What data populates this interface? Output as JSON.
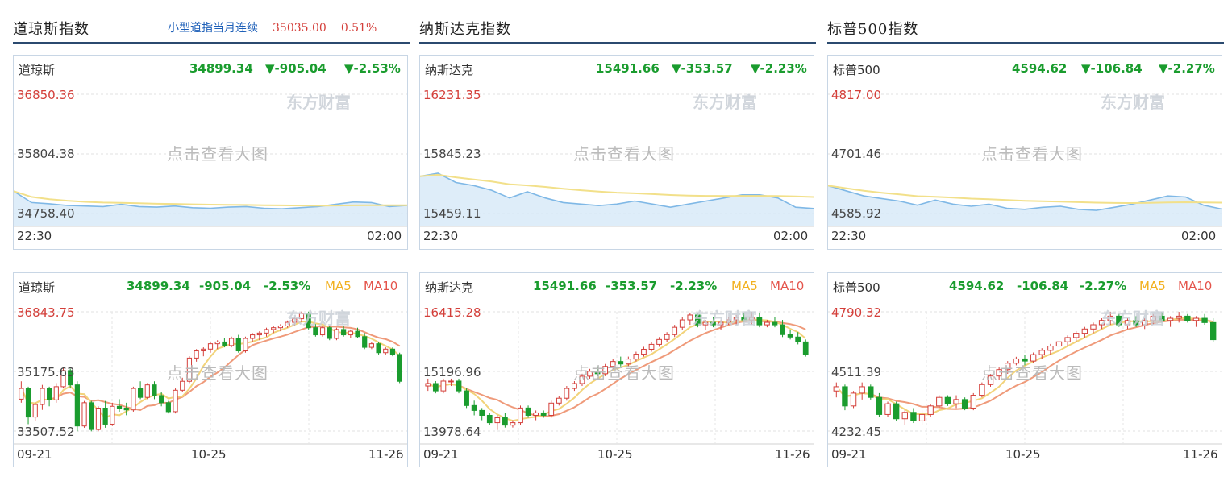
{
  "columns": [
    {
      "header": "道琼斯指数",
      "futures": {
        "name": "小型道指当月连续",
        "price": "35035.00",
        "pct": "0.51%"
      },
      "intraday": {
        "name": "道琼斯",
        "price": "34899.34",
        "change": "▼-905.04",
        "pct": "▼-2.53%",
        "y_high": "36850.36",
        "y_mid": "35804.38",
        "y_low": "34758.40",
        "x_start": "22:30",
        "x_end": "02:00"
      },
      "kline": {
        "name": "道琼斯",
        "price": "34899.34",
        "change": "-905.04",
        "pct": "-2.53%",
        "ma5": "MA5",
        "ma10": "MA10",
        "y_high": "36843.75",
        "y_mid": "35175.63",
        "y_low": "33507.52",
        "x_ticks": [
          "09-21",
          "10-25",
          "11-26"
        ]
      }
    },
    {
      "header": "纳斯达克指数",
      "intraday": {
        "name": "纳斯达克",
        "price": "15491.66",
        "change": "▼-353.57",
        "pct": "▼-2.23%",
        "y_high": "16231.35",
        "y_mid": "15845.23",
        "y_low": "15459.11",
        "x_start": "22:30",
        "x_end": "02:00"
      },
      "kline": {
        "name": "纳斯达克",
        "price": "15491.66",
        "change": "-353.57",
        "pct": "-2.23%",
        "ma5": "MA5",
        "ma10": "MA10",
        "y_high": "16415.28",
        "y_mid": "15196.96",
        "y_low": "13978.64",
        "x_ticks": [
          "09-21",
          "10-25",
          "11-26"
        ]
      }
    },
    {
      "header": "标普500指数",
      "intraday": {
        "name": "标普500",
        "price": "4594.62",
        "change": "▼-106.84",
        "pct": "▼-2.27%",
        "y_high": "4817.00",
        "y_mid": "4701.46",
        "y_low": "4585.92",
        "x_start": "22:30",
        "x_end": "02:00"
      },
      "kline": {
        "name": "标普500",
        "price": "4594.62",
        "change": "-106.84",
        "pct": "-2.27%",
        "ma5": "MA5",
        "ma10": "MA10",
        "y_high": "4790.32",
        "y_mid": "4511.39",
        "y_low": "4232.45",
        "x_ticks": [
          "09-21",
          "10-25",
          "11-26"
        ]
      }
    }
  ],
  "watermark": "东方财富",
  "hint": "点击查看大图",
  "colors": {
    "up": "#d43f3a",
    "down": "#1a9c2e",
    "ma5": "#f2d37a",
    "ma10": "#ef9a7a",
    "area": "#d6e9f8",
    "line": "#7fb8e6",
    "prev_close": "#f2e08a"
  },
  "chart_data": [
    {
      "type": "line",
      "title": "道琼斯",
      "x_range": [
        "22:30",
        "02:00"
      ],
      "ylim": [
        34758.4,
        36850.36
      ],
      "values": [
        35150,
        34950,
        34930,
        34900,
        34890,
        34880,
        34920,
        34880,
        34870,
        34890,
        34860,
        34850,
        34870,
        34880,
        34850,
        34840,
        34860,
        34880,
        34920,
        34960,
        34950,
        34880,
        34899.34
      ],
      "prev_close": 35804.38
    },
    {
      "type": "line",
      "title": "纳斯达克",
      "x_range": [
        "22:30",
        "02:00"
      ],
      "ylim": [
        15459.11,
        16231.35
      ],
      "values": [
        15700,
        15720,
        15660,
        15640,
        15610,
        15560,
        15600,
        15560,
        15530,
        15520,
        15510,
        15520,
        15540,
        15520,
        15500,
        15520,
        15540,
        15560,
        15580,
        15580,
        15560,
        15500,
        15491.66
      ],
      "prev_close": 15845.23
    },
    {
      "type": "line",
      "title": "标普500",
      "x_range": [
        "22:30",
        "02:00"
      ],
      "ylim": [
        4585.92,
        4817.0
      ],
      "values": [
        4640,
        4630,
        4620,
        4615,
        4610,
        4602,
        4612,
        4604,
        4600,
        4604,
        4596,
        4594,
        4598,
        4600,
        4594,
        4592,
        4598,
        4604,
        4612,
        4620,
        4618,
        4602,
        4594.62
      ],
      "prev_close": 4701.46
    },
    {
      "type": "candlestick",
      "title": "道琼斯",
      "ylim": [
        33507.52,
        36843.75
      ],
      "x_ticks": [
        "09-21",
        "10-25",
        "11-26"
      ],
      "ohlc": [
        [
          34400,
          34900,
          34300,
          34700
        ],
        [
          34700,
          34750,
          33700,
          33900
        ],
        [
          33900,
          34300,
          33800,
          34250
        ],
        [
          34250,
          34800,
          34100,
          34700
        ],
        [
          34700,
          34750,
          34200,
          34380
        ],
        [
          34380,
          34850,
          34300,
          34750
        ],
        [
          34750,
          35300,
          34700,
          35200
        ],
        [
          35200,
          35250,
          34700,
          34800
        ],
        [
          34800,
          34900,
          33500,
          33650
        ],
        [
          33650,
          34350,
          33600,
          34300
        ],
        [
          34300,
          34350,
          33500,
          33550
        ],
        [
          33550,
          34200,
          33500,
          34150
        ],
        [
          34150,
          34350,
          33600,
          33700
        ],
        [
          33700,
          34300,
          33650,
          34200
        ],
        [
          34200,
          34400,
          34050,
          34150
        ],
        [
          34150,
          34300,
          33950,
          34100
        ],
        [
          34100,
          34750,
          34050,
          34700
        ],
        [
          34700,
          34900,
          34400,
          34450
        ],
        [
          34450,
          34850,
          34400,
          34800
        ],
        [
          34800,
          34900,
          34400,
          34500
        ],
        [
          34500,
          34600,
          34200,
          34300
        ],
        [
          34300,
          34350,
          34000,
          34050
        ],
        [
          34050,
          34700,
          34000,
          34650
        ],
        [
          34650,
          35000,
          34600,
          34900
        ],
        [
          34900,
          35600,
          34850,
          35550
        ],
        [
          35550,
          35800,
          35450,
          35750
        ],
        [
          35750,
          35850,
          35600,
          35800
        ],
        [
          35800,
          36000,
          35700,
          35950
        ],
        [
          35950,
          36050,
          35800,
          36000
        ],
        [
          36000,
          36100,
          35850,
          35900
        ],
        [
          35900,
          36150,
          35850,
          36100
        ],
        [
          36100,
          36200,
          35700,
          35750
        ],
        [
          35750,
          36150,
          35700,
          36100
        ],
        [
          36100,
          36250,
          36000,
          36200
        ],
        [
          36200,
          36300,
          36050,
          36250
        ],
        [
          36250,
          36400,
          36150,
          36350
        ],
        [
          36350,
          36450,
          36250,
          36400
        ],
        [
          36400,
          36500,
          36300,
          36450
        ],
        [
          36450,
          36600,
          36400,
          36550
        ],
        [
          36550,
          36700,
          36450,
          36650
        ],
        [
          36650,
          36850,
          36550,
          36800
        ],
        [
          36800,
          36850,
          36350,
          36400
        ],
        [
          36400,
          36500,
          36150,
          36200
        ],
        [
          36200,
          36450,
          36150,
          36400
        ],
        [
          36400,
          36450,
          36050,
          36100
        ],
        [
          36100,
          36400,
          36050,
          36350
        ],
        [
          36350,
          36450,
          36150,
          36200
        ],
        [
          36200,
          36350,
          36100,
          36300
        ],
        [
          36300,
          36400,
          36100,
          36150
        ],
        [
          36150,
          36250,
          35800,
          35850
        ],
        [
          35850,
          36000,
          35800,
          35950
        ],
        [
          35950,
          36000,
          35650,
          35700
        ],
        [
          35700,
          35850,
          35650,
          35800
        ],
        [
          35800,
          35850,
          35600,
          35650
        ],
        [
          35650,
          35700,
          34850,
          34900
        ]
      ]
    },
    {
      "type": "candlestick",
      "title": "纳斯达克",
      "ylim": [
        13978.64,
        16415.28
      ],
      "x_ticks": [
        "09-21",
        "10-25",
        "11-26"
      ],
      "ohlc": [
        [
          14900,
          15050,
          14800,
          14950
        ],
        [
          14950,
          15000,
          14750,
          14800
        ],
        [
          14800,
          15050,
          14750,
          15000
        ],
        [
          15000,
          15050,
          14900,
          15000
        ],
        [
          15000,
          15050,
          14750,
          14800
        ],
        [
          14800,
          14850,
          14450,
          14500
        ],
        [
          14500,
          14600,
          14300,
          14400
        ],
        [
          14400,
          14450,
          14200,
          14300
        ],
        [
          14300,
          14350,
          14100,
          14150
        ],
        [
          14150,
          14300,
          14000,
          14250
        ],
        [
          14250,
          14350,
          14050,
          14100
        ],
        [
          14100,
          14200,
          14050,
          14150
        ],
        [
          14150,
          14500,
          14100,
          14450
        ],
        [
          14450,
          14500,
          14250,
          14300
        ],
        [
          14300,
          14400,
          14200,
          14350
        ],
        [
          14350,
          14400,
          14250,
          14300
        ],
        [
          14300,
          14600,
          14250,
          14550
        ],
        [
          14550,
          14700,
          14500,
          14650
        ],
        [
          14650,
          14900,
          14600,
          14850
        ],
        [
          14850,
          15000,
          14800,
          14950
        ],
        [
          14950,
          15150,
          14900,
          15100
        ],
        [
          15100,
          15250,
          15050,
          15200
        ],
        [
          15200,
          15300,
          15100,
          15150
        ],
        [
          15150,
          15350,
          15100,
          15300
        ],
        [
          15300,
          15450,
          15250,
          15400
        ],
        [
          15400,
          15500,
          15300,
          15350
        ],
        [
          15350,
          15500,
          15300,
          15450
        ],
        [
          15450,
          15600,
          15400,
          15550
        ],
        [
          15550,
          15700,
          15500,
          15650
        ],
        [
          15650,
          15800,
          15600,
          15750
        ],
        [
          15750,
          15900,
          15700,
          15850
        ],
        [
          15850,
          16000,
          15800,
          15950
        ],
        [
          15950,
          16150,
          15900,
          16100
        ],
        [
          16100,
          16300,
          16050,
          16250
        ],
        [
          16250,
          16400,
          16150,
          16350
        ],
        [
          16350,
          16400,
          16100,
          16150
        ],
        [
          16150,
          16250,
          16050,
          16200
        ],
        [
          16200,
          16300,
          16100,
          16150
        ],
        [
          16150,
          16250,
          16050,
          16200
        ],
        [
          16200,
          16300,
          16150,
          16250
        ],
        [
          16250,
          16350,
          16150,
          16300
        ],
        [
          16300,
          16400,
          16200,
          16250
        ],
        [
          16250,
          16415,
          16150,
          16300
        ],
        [
          16300,
          16400,
          16100,
          16150
        ],
        [
          16150,
          16250,
          16100,
          16200
        ],
        [
          16200,
          16300,
          16100,
          16150
        ],
        [
          16150,
          16250,
          15900,
          15950
        ],
        [
          15950,
          16050,
          15850,
          15900
        ],
        [
          15900,
          16000,
          15750,
          15800
        ],
        [
          15800,
          15850,
          15500,
          15550
        ]
      ]
    },
    {
      "type": "candlestick",
      "title": "标普500",
      "ylim": [
        4232.45,
        4790.32
      ],
      "x_ticks": [
        "09-21",
        "10-25",
        "11-26"
      ],
      "ohlc": [
        [
          4420,
          4460,
          4390,
          4440
        ],
        [
          4440,
          4450,
          4330,
          4350
        ],
        [
          4350,
          4420,
          4340,
          4410
        ],
        [
          4410,
          4460,
          4380,
          4440
        ],
        [
          4440,
          4450,
          4380,
          4390
        ],
        [
          4390,
          4410,
          4300,
          4310
        ],
        [
          4310,
          4370,
          4300,
          4360
        ],
        [
          4360,
          4370,
          4280,
          4290
        ],
        [
          4290,
          4330,
          4260,
          4320
        ],
        [
          4320,
          4340,
          4270,
          4280
        ],
        [
          4280,
          4330,
          4260,
          4310
        ],
        [
          4310,
          4360,
          4300,
          4350
        ],
        [
          4350,
          4400,
          4340,
          4390
        ],
        [
          4390,
          4400,
          4350,
          4360
        ],
        [
          4360,
          4400,
          4340,
          4380
        ],
        [
          4380,
          4390,
          4330,
          4340
        ],
        [
          4340,
          4410,
          4330,
          4400
        ],
        [
          4400,
          4460,
          4390,
          4450
        ],
        [
          4450,
          4500,
          4440,
          4490
        ],
        [
          4490,
          4530,
          4470,
          4520
        ],
        [
          4520,
          4560,
          4500,
          4550
        ],
        [
          4550,
          4580,
          4540,
          4570
        ],
        [
          4570,
          4590,
          4540,
          4560
        ],
        [
          4560,
          4600,
          4550,
          4590
        ],
        [
          4590,
          4620,
          4570,
          4610
        ],
        [
          4610,
          4640,
          4590,
          4630
        ],
        [
          4630,
          4660,
          4610,
          4650
        ],
        [
          4650,
          4680,
          4630,
          4670
        ],
        [
          4670,
          4700,
          4650,
          4690
        ],
        [
          4690,
          4720,
          4670,
          4710
        ],
        [
          4710,
          4740,
          4690,
          4730
        ],
        [
          4730,
          4760,
          4710,
          4750
        ],
        [
          4750,
          4790,
          4730,
          4770
        ],
        [
          4770,
          4780,
          4720,
          4730
        ],
        [
          4730,
          4760,
          4710,
          4750
        ],
        [
          4750,
          4770,
          4720,
          4730
        ],
        [
          4730,
          4760,
          4710,
          4750
        ],
        [
          4750,
          4780,
          4730,
          4770
        ],
        [
          4770,
          4790,
          4740,
          4750
        ],
        [
          4750,
          4770,
          4720,
          4760
        ],
        [
          4760,
          4790,
          4740,
          4770
        ],
        [
          4770,
          4780,
          4740,
          4750
        ],
        [
          4750,
          4770,
          4720,
          4760
        ],
        [
          4760,
          4780,
          4730,
          4740
        ],
        [
          4740,
          4760,
          4650,
          4660
        ]
      ]
    }
  ]
}
